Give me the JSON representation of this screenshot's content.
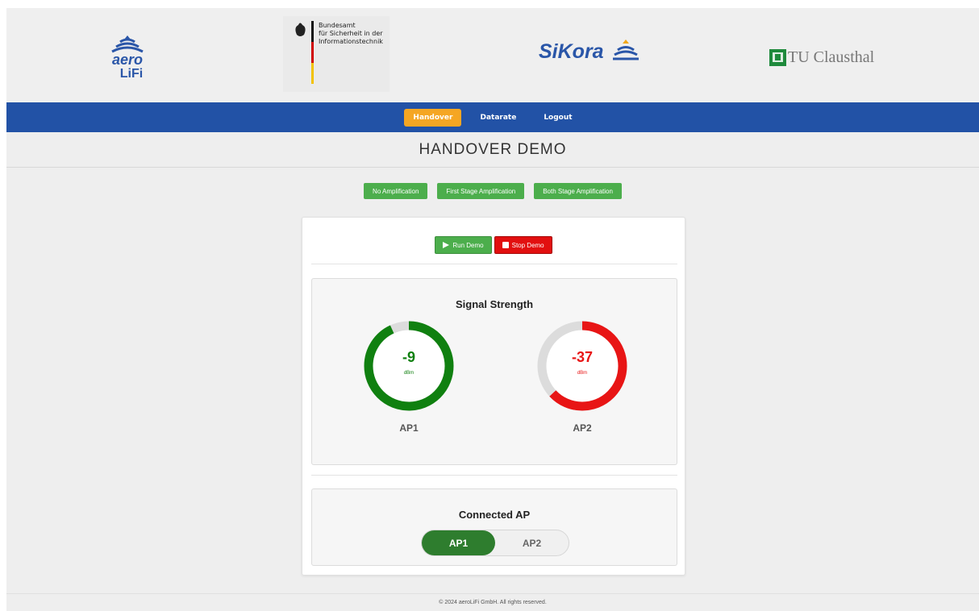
{
  "logos": {
    "aerolifi": {
      "line1": "aero",
      "line2": "LiFi"
    },
    "bsi": {
      "lines": [
        "Bundesamt",
        "für Sicherheit in der",
        "Informationstechnik"
      ]
    },
    "sikora": {
      "text": "SiKora"
    },
    "tu": {
      "text": "TU Clausthal"
    }
  },
  "nav": {
    "items": [
      {
        "label": "Handover",
        "active": true
      },
      {
        "label": "Datarate",
        "active": false
      },
      {
        "label": "Logout",
        "active": false
      }
    ]
  },
  "page_title": "HANDOVER DEMO",
  "amplification": {
    "buttons": [
      "No Amplification",
      "First Stage Amplification",
      "Both Stage Amplification"
    ]
  },
  "demo": {
    "run_label": "Run Demo",
    "stop_label": "Stop Demo"
  },
  "signal": {
    "title": "Signal Strength",
    "gauges": [
      {
        "label": "AP1",
        "value": "-9",
        "unit": "dBm",
        "fill": 0.93,
        "color": "#108010"
      },
      {
        "label": "AP2",
        "value": "-37",
        "unit": "dBm",
        "fill": 0.63,
        "color": "#e81515"
      }
    ]
  },
  "connected": {
    "title": "Connected AP",
    "options": [
      "AP1",
      "AP2"
    ],
    "selected": "AP1"
  },
  "footer": "© 2024 aeroLiFi GmbH. All rights reserved.",
  "colors": {
    "nav_bg": "#2252a6",
    "active_tab": "#f5a623",
    "green": "#4cae4c",
    "red": "#e20f0f"
  }
}
